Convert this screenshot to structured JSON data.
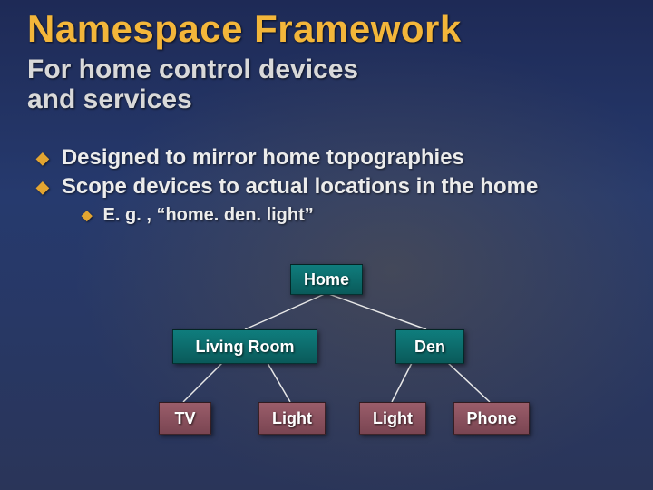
{
  "title": "Namespace Framework",
  "subtitle_line1": "For home control devices",
  "subtitle_line2": "and services",
  "bullets": {
    "b0": "Designed to mirror home topographies",
    "b1": "Scope devices to actual locations in the home",
    "sub0": "E. g. , “home. den. light”"
  },
  "diagram": {
    "root": "Home",
    "level2_left": "Living Room",
    "level2_right": "Den",
    "leaf_tv": "TV",
    "leaf_light_lr": "Light",
    "leaf_light_den": "Light",
    "leaf_phone": "Phone"
  },
  "colors": {
    "accent": "#f3b63a",
    "node_teal": "#0f7d7d",
    "node_plum": "#9a5d6a"
  }
}
